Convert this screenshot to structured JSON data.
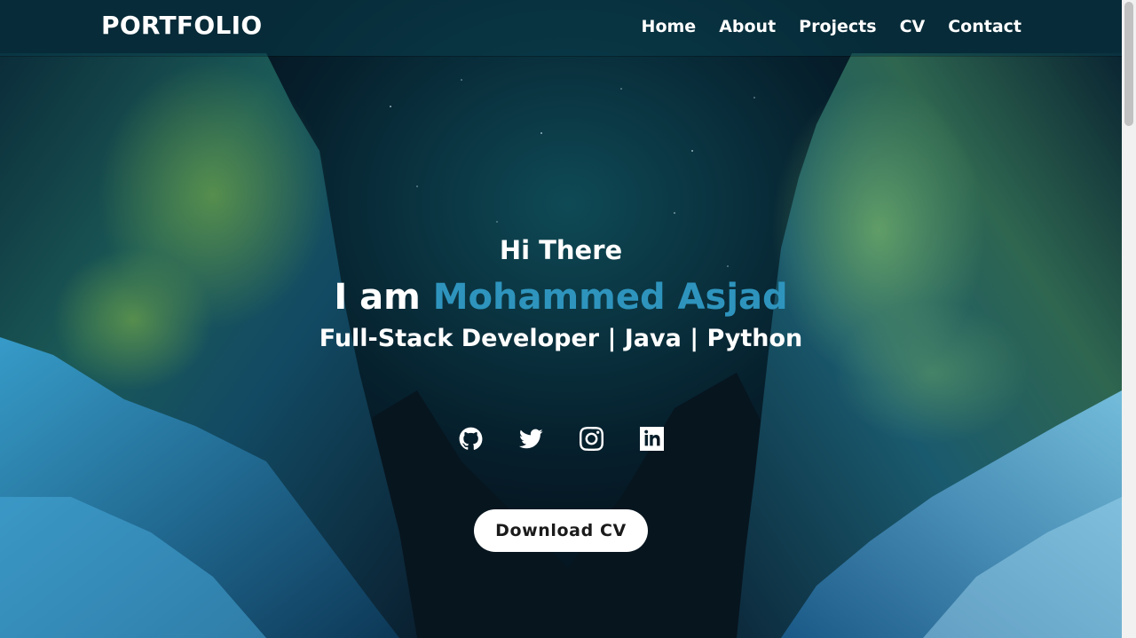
{
  "brand": "PORTFOLIO",
  "nav": [
    "Home",
    "About",
    "Projects",
    "CV",
    "Contact"
  ],
  "hero": {
    "greeting": "Hi There",
    "name_prefix": "I am",
    "name": "Mohammed Asjad",
    "role": "Full-Stack Developer | Java | Python"
  },
  "socials": [
    "github-icon",
    "twitter-icon",
    "instagram-icon",
    "linkedin-icon"
  ],
  "cta": "Download CV",
  "colors": {
    "accent": "#2e94bd",
    "navbar": "#0a3c4b",
    "button_bg": "#ffffff"
  }
}
